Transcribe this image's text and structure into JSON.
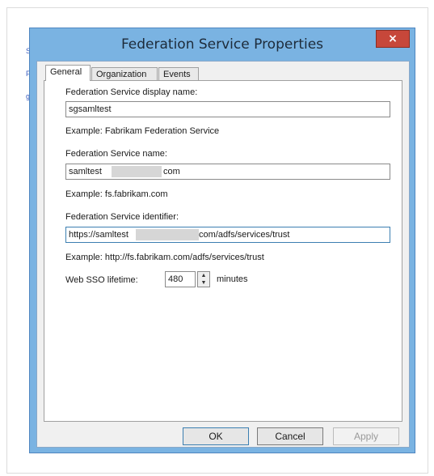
{
  "dialog": {
    "title": "Federation Service Properties",
    "close_label": "×"
  },
  "sidebar_fragments": [
    "S",
    "F",
    "g"
  ],
  "tabs": [
    {
      "label": "General",
      "active": true
    },
    {
      "label": "Organization",
      "active": false
    },
    {
      "label": "Events",
      "active": false
    }
  ],
  "general": {
    "display_name_label": "Federation Service display name:",
    "display_name_value": "sgsamltest",
    "display_name_example": "Example: Fabrikam Federation Service",
    "service_name_label": "Federation Service name:",
    "service_name_prefix": "samltest",
    "service_name_suffix": "com",
    "service_name_example": "Example: fs.fabrikam.com",
    "identifier_label": "Federation Service identifier:",
    "identifier_prefix": "https://samltest",
    "identifier_suffix": "com/adfs/services/trust",
    "identifier_example": "Example: http://fs.fabrikam.com/adfs/services/trust",
    "sso_label": "Web SSO lifetime:",
    "sso_value": "480",
    "sso_unit": "minutes"
  },
  "buttons": {
    "ok": "OK",
    "cancel": "Cancel",
    "apply": "Apply"
  },
  "colors": {
    "title_bar": "#7ab3e2",
    "close_button": "#c7473a",
    "client_bg": "#f0f0f0"
  }
}
